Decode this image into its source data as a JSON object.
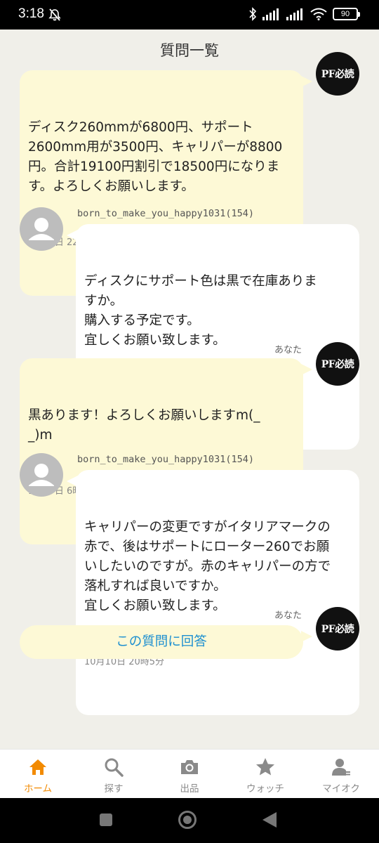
{
  "status_bar": {
    "time": "3:18",
    "battery": "90",
    "icons": [
      "mute-icon",
      "bluetooth-icon",
      "signal-icon",
      "signal-icon",
      "wifi-icon",
      "battery-icon"
    ]
  },
  "header": {
    "title": "質問一覧"
  },
  "messages": [
    {
      "sender": "you",
      "avatar_text": "PF必読",
      "text": "ディスク260mmが6800円、サポート\n2600mm用が3500円、キャリパーが8800\n円。合計19100円割引で18500円になりま\nす。よろしくお願いします。",
      "time": "10月8日 22時3分"
    },
    {
      "sender": "other",
      "username": "born_to_make_you_happy1031(154)",
      "text": "ディスクにサポート色は黒で在庫ありま\nすか。\n購入する予定です。\n宜しくお願い致します。",
      "time": "10月8日 22時22分"
    },
    {
      "sender": "you",
      "you_label": "あなた",
      "avatar_text": "PF必読",
      "text": "黒あります！よろしくお願いしますm(_\n_)m",
      "time": "10月9日 6時37分"
    },
    {
      "sender": "other",
      "username": "born_to_make_you_happy1031(154)",
      "text": "キャリパーの変更ですがイタリアマークの\n赤で、後はサポートにローター260でお願\nいしたいのですが。赤のキャリパーの方で\n落札すれば良いですか。\n宜しくお願い致します。",
      "time": "10月10日 20時5分"
    }
  ],
  "reply": {
    "you_label": "あなた",
    "avatar_text": "PF必読",
    "button_label": "この質問に回答"
  },
  "tabbar": {
    "active": "home",
    "colors": {
      "active": "#f28a00",
      "inactive": "#8a8a8a"
    },
    "items": [
      {
        "label": "ホーム",
        "icon": "home-icon"
      },
      {
        "label": "探す",
        "icon": "search-icon"
      },
      {
        "label": "出品",
        "icon": "camera-icon"
      },
      {
        "label": "ウォッチ",
        "icon": "star-icon"
      },
      {
        "label": "マイオク",
        "icon": "user-icon"
      }
    ]
  },
  "colors": {
    "background": "#f0efe9",
    "my_bubble": "#fdf9d6",
    "their_bubble": "#ffffff",
    "link": "#1e90d0"
  }
}
